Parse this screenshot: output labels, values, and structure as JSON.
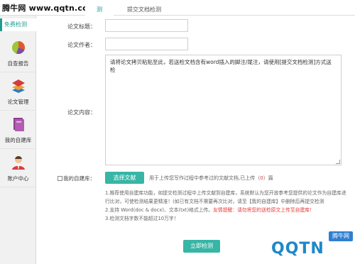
{
  "watermark": "腾牛网 www.qqtn.com",
  "tabs": {
    "active": "测",
    "inactive": "提交文档检测"
  },
  "sidebar": {
    "first": "免费检测",
    "items": [
      {
        "label": "自查报告",
        "icon": "pie-chart-icon"
      },
      {
        "label": "论文管理",
        "icon": "layers-icon"
      },
      {
        "label": "我的自建库",
        "icon": "folder-icon"
      },
      {
        "label": "账户中心",
        "icon": "user-icon"
      }
    ]
  },
  "form": {
    "title_label": "论文标题：",
    "author_label": "论文作者：",
    "content_label": "论文内容：",
    "content_placeholder": "请将论文拷贝粘贴至此，若送检文档含有word插入的脚注/尾注，请使用[提交文档检测]方式送检"
  },
  "library": {
    "checkbox_label": "我的自建库：",
    "select_button": "选择文献",
    "hint_prefix": "用于上传您写作过程中参考过的文献文档,已上传（",
    "count": "0",
    "hint_suffix": "）篇"
  },
  "notes": {
    "line1": "1.推荐使用自建库功能，如提交检测过程中上传文献到自建库，系统默认为您开放参考您提供的论文作为自建库进行比对，可使检测结果更精准！(如已有文档不需要再次比对，请至【我的自建库】中删除后再提交检测",
    "line2_prefix": "2.支持 Word(doc & docx)、文本(txt)格式上传。",
    "line2_warning": "友情提醒：请勿将您的送检原文上传至自建库！",
    "line3": "3.检测文档字数不能超过10万字！"
  },
  "submit_button": "立即检测",
  "corner_logo": {
    "text": "QQTN",
    "badge": "腾牛网"
  },
  "colors": {
    "accent": "#37b5a5",
    "accent_text": "#1d9c8f",
    "warning": "#e53935",
    "logo_blue": "#1e88c8"
  }
}
